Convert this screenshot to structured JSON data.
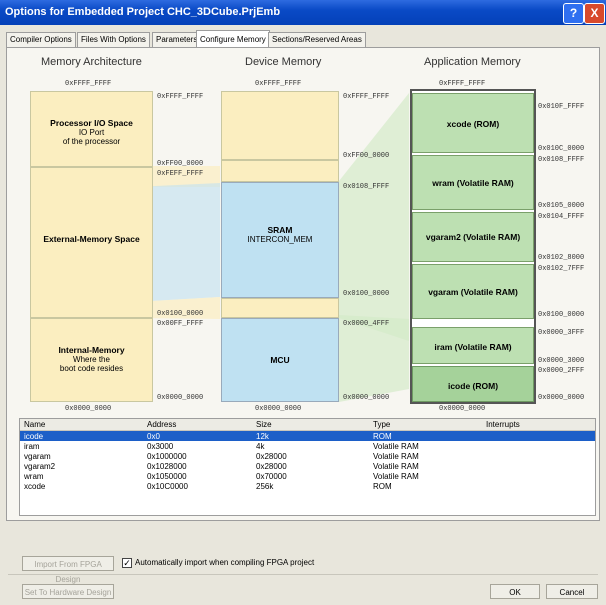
{
  "window": {
    "title": "Options for Embedded Project CHC_3DCube.PrjEmb",
    "help_label": "?",
    "close_label": "X"
  },
  "tabs": [
    "Compiler Options",
    "Files With Options",
    "Parameters",
    "Configure Memory",
    "Sections/Reserved Areas"
  ],
  "diagram": {
    "headers": {
      "arch": "Memory Architecture",
      "device": "Device Memory",
      "app": "Application Memory"
    },
    "arch_blocks": [
      {
        "title": "Processor I/O Space",
        "lines": [
          "IO Port",
          "of the processor"
        ]
      },
      {
        "title": "External-Memory Space",
        "lines": []
      },
      {
        "title": "Internal-Memory",
        "lines": [
          "Where the",
          "boot code resides"
        ]
      }
    ],
    "device_blocks": [
      {
        "title": "SRAM",
        "lines": [
          "INTERCON_MEM"
        ]
      },
      {
        "title": "MCU",
        "lines": []
      }
    ],
    "app_blocks": [
      "xcode (ROM)",
      "wram (Volatile RAM)",
      "vgaram2 (Volatile RAM)",
      "vgaram (Volatile RAM)",
      "iram (Volatile RAM)",
      "icode (ROM)"
    ],
    "addresses": {
      "arch_top": "0xFFFF_FFFF",
      "arch_bottom": "0x0000_0000",
      "dev_top": "0xFFFF_FFFF",
      "dev_bottom": "0x0000_0000",
      "app_top": "0xFFFF_FFFF",
      "app_bottom": "0x0000_0000",
      "a1": "0xFFFF_FFFF",
      "a2": "0xFF00_0000",
      "a3": "0xFEFF_FFFF",
      "a4": "0x0100_0000",
      "a5": "0x00FF_FFFF",
      "a6": "0x0000_0000",
      "d1": "0xFFFF_FFFF",
      "d2": "0xFF00_0000",
      "d3": "0x0108_FFFF",
      "d4": "0x0100_0000",
      "d5": "0x0000_4FFF",
      "d6": "0x0000_0000",
      "r1": "0x010F_FFFF",
      "r2": "0x010C_0000",
      "r3": "0x0108_FFFF",
      "r4": "0x0105_0000",
      "r5": "0x0104_FFFF",
      "r6": "0x0102_8000",
      "r7": "0x0102_7FFF",
      "r8": "0x0100_0000",
      "r9": "0x0000_3FFF",
      "r10": "0x0000_3000",
      "r11": "0x0000_2FFF",
      "r12": "0x0000_0000"
    }
  },
  "table": {
    "columns": [
      "Name",
      "Address",
      "Size",
      "Type",
      "Interrupts"
    ],
    "rows": [
      {
        "name": "icode",
        "address": "0x0",
        "size": "12k",
        "type": "ROM",
        "interrupts": ""
      },
      {
        "name": "iram",
        "address": "0x3000",
        "size": "4k",
        "type": "Volatile RAM",
        "interrupts": ""
      },
      {
        "name": "vgaram",
        "address": "0x1000000",
        "size": "0x28000",
        "type": "Volatile RAM",
        "interrupts": ""
      },
      {
        "name": "vgaram2",
        "address": "0x1028000",
        "size": "0x28000",
        "type": "Volatile RAM",
        "interrupts": ""
      },
      {
        "name": "wram",
        "address": "0x1050000",
        "size": "0x70000",
        "type": "Volatile RAM",
        "interrupts": ""
      },
      {
        "name": "xcode",
        "address": "0x10C0000",
        "size": "256k",
        "type": "ROM",
        "interrupts": ""
      }
    ]
  },
  "footer": {
    "import_button": "Import From FPGA Design",
    "auto_import_label": "Automatically import when compiling FPGA project",
    "set_button": "Set To Hardware Design",
    "ok_button": "OK",
    "cancel_button": "Cancel"
  }
}
